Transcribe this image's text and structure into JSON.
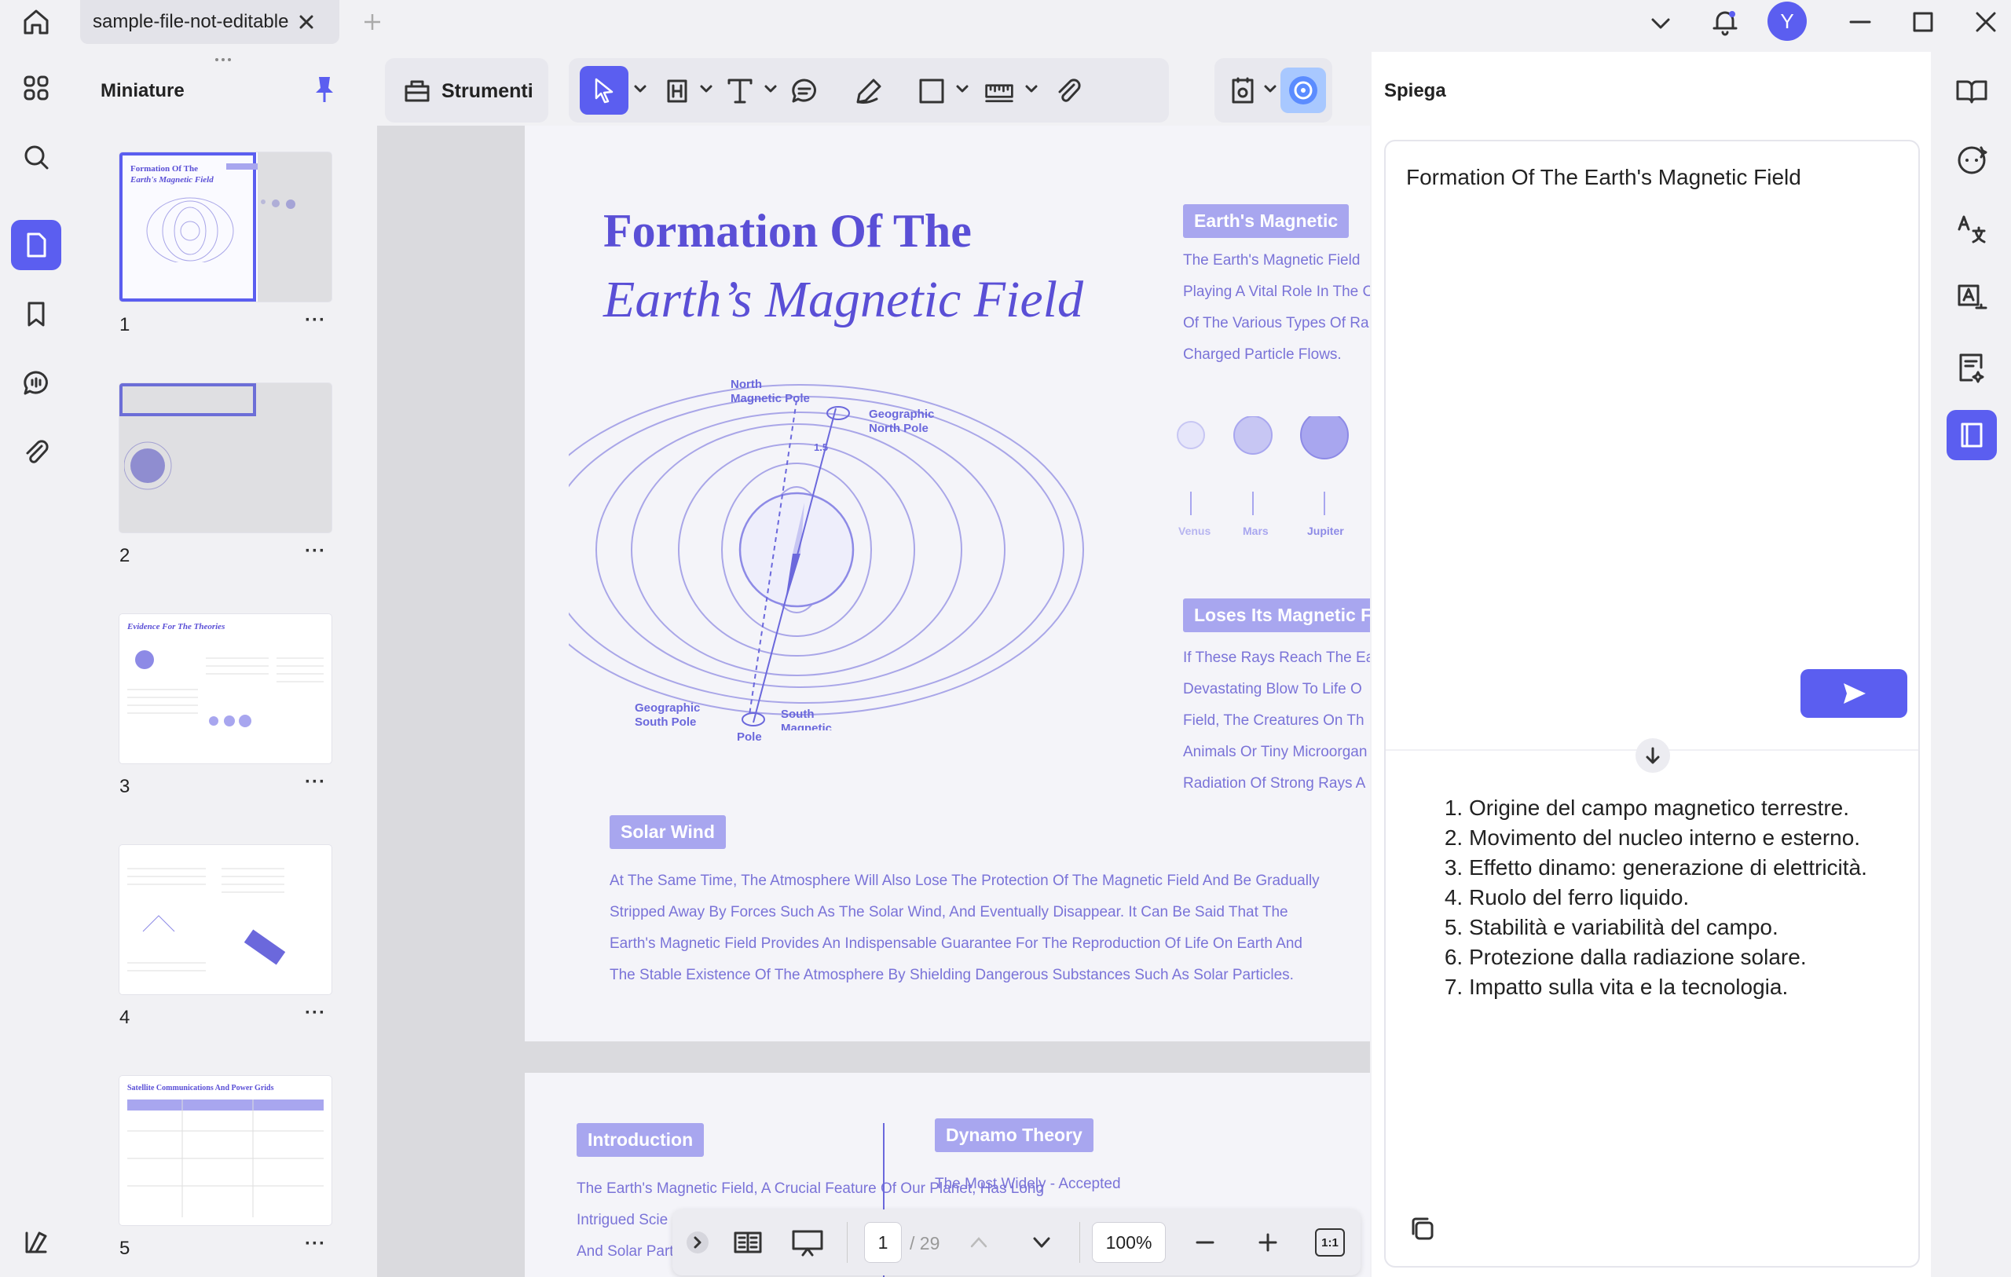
{
  "titlebar": {
    "tab_title": "sample-file-not-editable",
    "avatar_letter": "Y"
  },
  "thumbnails": {
    "title": "Miniature",
    "pages": [
      {
        "num": "1",
        "more": "···"
      },
      {
        "num": "2",
        "more": "···"
      },
      {
        "num": "3",
        "more": "···"
      },
      {
        "num": "4",
        "more": "···"
      },
      {
        "num": "5",
        "more": "···"
      }
    ],
    "thumb3_title": "Evidence For The Theories",
    "thumb5_title": "Satellite Communications And Power Grids"
  },
  "toolbar": {
    "tools_label": "Strumenti"
  },
  "document": {
    "title_line1": "Formation Of The",
    "title_line2": "Earth’s Magnetic Field",
    "diagram": {
      "north_magnetic_pole": [
        "North",
        "Magnetic Pole"
      ],
      "geographic_north_pole": [
        "Geographic",
        "North Pole"
      ],
      "geographic_south_pole": [
        "Geographic",
        "South Pole"
      ],
      "south_magnetic_pole": [
        "South",
        "Magnetic",
        "Pole"
      ],
      "angle": "1.5"
    },
    "earth_magnetic_label": "Earth's Magnetic",
    "earth_magnetic_text": [
      "The Earth's Magnetic Field",
      "Playing A Vital Role In The C",
      "Of The Various Types Of Ra",
      "Charged Particle Flows."
    ],
    "planets": [
      "Venus",
      "Mars",
      "Jupiter"
    ],
    "loses_label": "Loses Its Magnetic Fi",
    "loses_text": [
      "If These Rays Reach The Ea",
      "Devastating Blow To Life O",
      "Field, The Creatures On Th",
      "Animals Or Tiny Microorgan",
      "Radiation Of Strong Rays A"
    ],
    "solar_wind_label": "Solar Wind",
    "solar_wind_text": [
      "At The Same Time, The Atmosphere Will Also Lose The Protection Of The Magnetic Field And Be Gradually",
      "Stripped Away By Forces Such As The Solar Wind, And Eventually Disappear. It Can Be Said That The",
      "Earth's Magnetic Field Provides An Indispensable Guarantee For The Reproduction Of Life On Earth And",
      "The Stable Existence Of The Atmosphere By Shielding Dangerous Substances Such As Solar Particles."
    ],
    "intro_label": "Introduction",
    "intro_text": [
      "The Earth's Magnetic Field, A Crucial Feature Of Our Planet, Has Long",
      "Intrigued Scie",
      "And Solar Part"
    ],
    "dynamo_label": "Dynamo Theory",
    "dynamo_text": [
      "The Most Widely - Accepted The"
    ]
  },
  "bottombar": {
    "page_current": "1",
    "page_total": "/ 29",
    "zoom": "100%",
    "fit": "1:1"
  },
  "panel": {
    "title": "Spiega",
    "input_text": "Formation Of The Earth's Magnetic Field",
    "response": [
      "Origine del campo magnetico terrestre.",
      "Movimento del nucleo interno e esterno.",
      "Effetto dinamo: generazione di elettricità.",
      "Ruolo del ferro liquido.",
      "Stabilità e variabilità del campo.",
      "Protezione dalla radiazione solare.",
      "Impatto sulla vita e la tecnologia."
    ]
  },
  "colors": {
    "accent": "#5b5ef0",
    "doc_purple": "#5a4fd6",
    "label_bg": "#a8a6ef"
  }
}
